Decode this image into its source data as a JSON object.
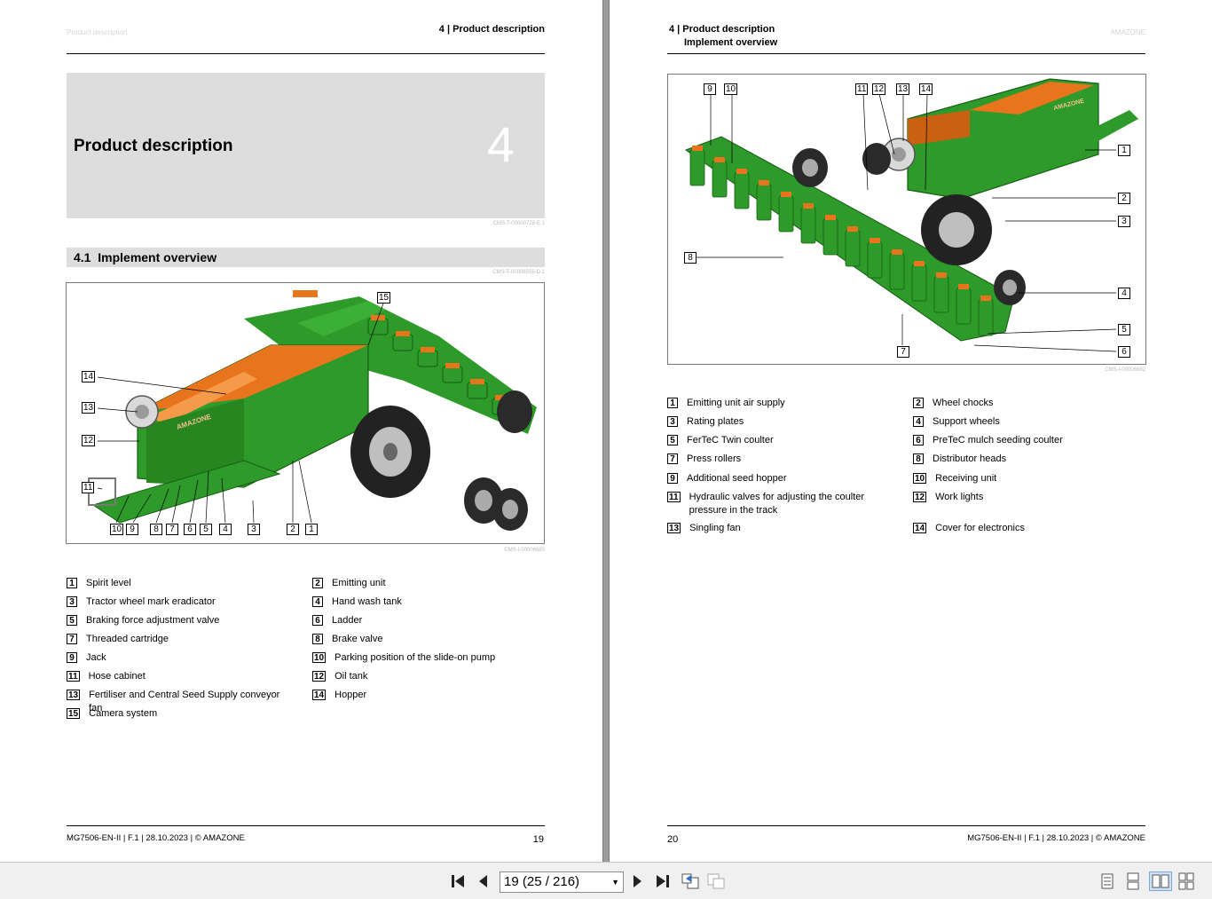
{
  "left_page": {
    "header": "4 | Product description",
    "ghost_header": "Product description",
    "chapter": {
      "title": "Product description",
      "number": "4",
      "doc_id": "CMS-T-00000728-E.1"
    },
    "section": {
      "number": "4.1",
      "title": "Implement overview",
      "doc_id": "CMS-T-00008555-D.1"
    },
    "figure_id": "CMS-I-00006683",
    "callouts": [
      "15",
      "14",
      "13",
      "12",
      "11",
      "10",
      "9",
      "8",
      "7",
      "6",
      "5",
      "4",
      "3",
      "2",
      "1"
    ],
    "legend": [
      {
        "num": "1",
        "text": "Spirit level"
      },
      {
        "num": "2",
        "text": "Emitting unit"
      },
      {
        "num": "3",
        "text": "Tractor wheel mark eradicator"
      },
      {
        "num": "4",
        "text": "Hand wash tank"
      },
      {
        "num": "5",
        "text": "Braking force adjustment valve"
      },
      {
        "num": "6",
        "text": "Ladder"
      },
      {
        "num": "7",
        "text": "Threaded cartridge"
      },
      {
        "num": "8",
        "text": "Brake valve"
      },
      {
        "num": "9",
        "text": "Jack"
      },
      {
        "num": "10",
        "text": "Parking position of the slide-on pump"
      },
      {
        "num": "11",
        "text": "Hose cabinet"
      },
      {
        "num": "12",
        "text": "Oil tank"
      },
      {
        "num": "13",
        "text": "Fertiliser and Central Seed Supply conveyor fan"
      },
      {
        "num": "14",
        "text": "Hopper"
      },
      {
        "num": "15",
        "text": "Camera system"
      }
    ],
    "footer": "MG7506-EN-II | F.1 | 28.10.2023 | © AMAZONE",
    "page_number": "19"
  },
  "right_page": {
    "header_line1": "4 | Product description",
    "header_line2": "Implement overview",
    "ghost_header": "AMAZONE",
    "figure_id": "CMS-I-00006682",
    "callouts": [
      "9",
      "10",
      "11",
      "12",
      "13",
      "14",
      "1",
      "2",
      "3",
      "8",
      "4",
      "5",
      "6",
      "7"
    ],
    "legend": [
      {
        "num": "1",
        "text": "Emitting unit air supply"
      },
      {
        "num": "2",
        "text": "Wheel chocks"
      },
      {
        "num": "3",
        "text": "Rating plates"
      },
      {
        "num": "4",
        "text": "Support wheels"
      },
      {
        "num": "5",
        "text": "FerTeC Twin coulter"
      },
      {
        "num": "6",
        "text": "PreTeC mulch seeding coulter"
      },
      {
        "num": "7",
        "text": "Press rollers"
      },
      {
        "num": "8",
        "text": "Distributor heads"
      },
      {
        "num": "9",
        "text": "Additional seed hopper"
      },
      {
        "num": "10",
        "text": "Receiving unit"
      },
      {
        "num": "11",
        "text": "Hydraulic valves for adjusting the coulter pressure in the track"
      },
      {
        "num": "12",
        "text": "Work lights"
      },
      {
        "num": "13",
        "text": "Singling fan"
      },
      {
        "num": "14",
        "text": "Cover for electronics"
      }
    ],
    "footer": "MG7506-EN-II | F.1 | 28.10.2023 | © AMAZONE",
    "page_number": "20"
  },
  "machine_brand_label": "AMAZONE",
  "toolbar": {
    "page_field": "19 (25 / 216)",
    "buttons": [
      "first-page-icon",
      "previous-page-icon",
      "next-page-icon",
      "last-page-icon",
      "previous-view-icon",
      "next-view-icon",
      "single-page-view-icon",
      "continuous-view-icon",
      "facing-pages-view-icon",
      "continuous-facing-view-icon"
    ]
  },
  "colors": {
    "machine_green": "#2e9a2a",
    "machine_orange": "#e8741c",
    "chapter_box": "#dddddd",
    "viewer_bg": "#ababab"
  }
}
